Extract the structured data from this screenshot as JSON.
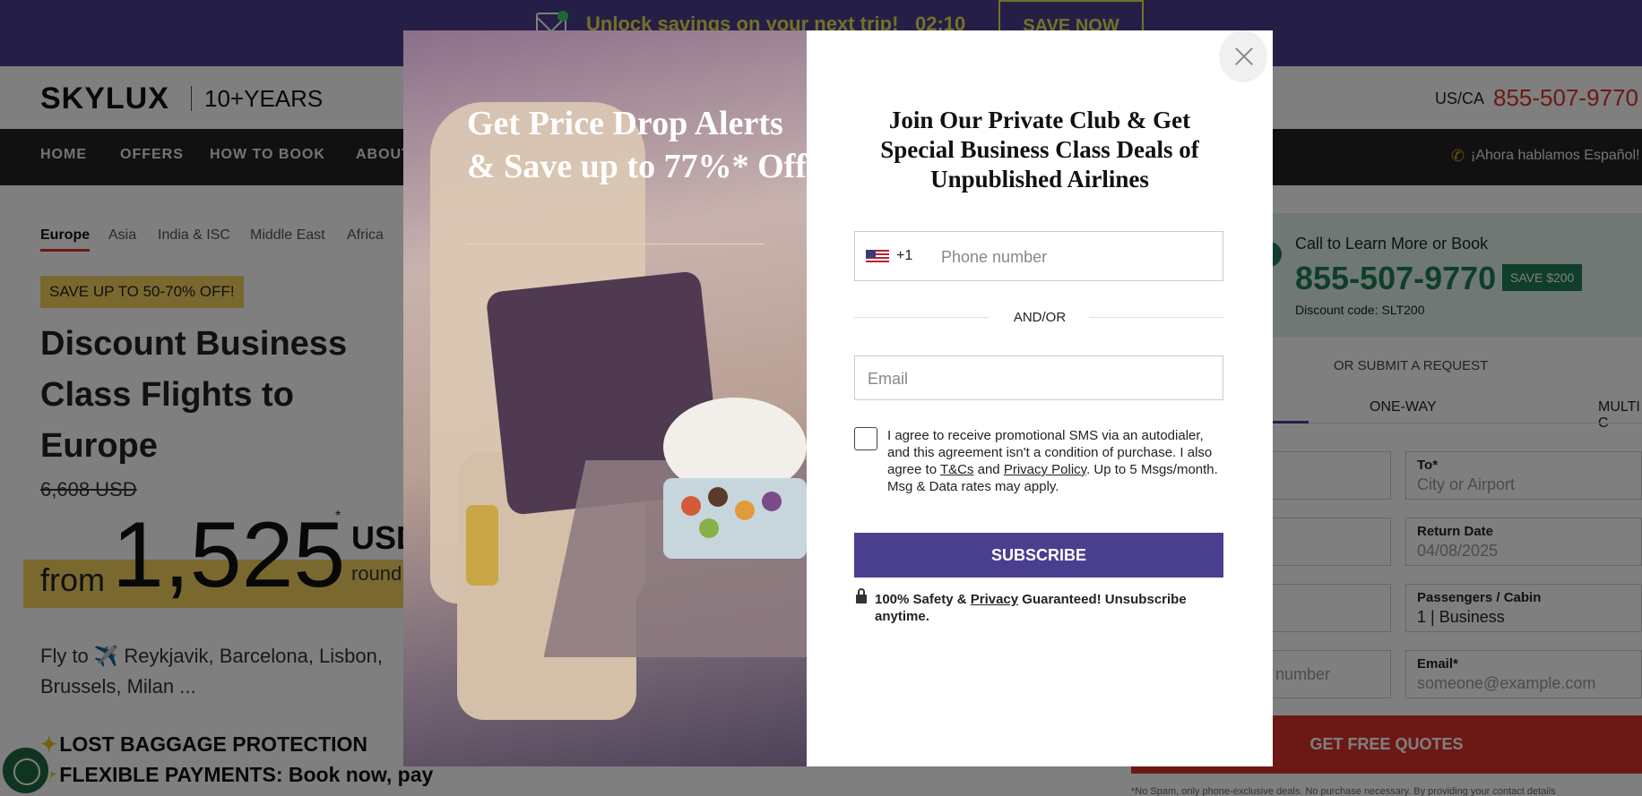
{
  "promo": {
    "text": "Unlock savings on your next trip!",
    "timer": "02:10",
    "button": "SAVE NOW"
  },
  "header": {
    "logo": "SKYLUX",
    "years": "10+YEARS",
    "region": "US/CA",
    "phone": "855-507-9770"
  },
  "nav": {
    "items": [
      "HOME",
      "OFFERS",
      "HOW TO BOOK",
      "ABOUT"
    ],
    "spanish": "¡Ahora hablamos Español!"
  },
  "region_tabs": [
    "Europe",
    "Asia",
    "India & ISC",
    "Middle East",
    "Africa"
  ],
  "main": {
    "badge": "SAVE UP TO 50-70% OFF!",
    "title": "Discount Business Class Flights to Europe",
    "old_price": "6,608 USD",
    "from": "from",
    "price": "1,525",
    "asterisk": "*",
    "currency": "USD",
    "round": "round",
    "fly_to": "Fly to ✈️ Reykjavik, Barcelona, Lisbon, Brussels, Milan ...",
    "perks": [
      "LOST BAGGAGE PROTECTION",
      "FLEXIBLE PAYMENTS: Book now, pay"
    ]
  },
  "request": {
    "call_title": "Call to Learn More or Book",
    "call_phone": "855-507-9770",
    "call_save": "SAVE $200",
    "discount_code": "Discount code: SLT200",
    "or_submit": "OR SUBMIT A REQUEST",
    "trip_tabs": [
      "ONE-WAY",
      "MULTI C"
    ],
    "to_label": "To*",
    "to_placeholder": "City or Airport",
    "return_label": "Return Date",
    "return_value": "04/08/2025",
    "passengers_label": "Passengers / Cabin",
    "passengers_value": "1 | Business",
    "phone_placeholder_fragment": "number",
    "email_label": "Email*",
    "email_placeholder": "someone@example.com",
    "quote_button": "GET FREE QUOTES",
    "disclaimer": "*No Spam, only phone-exclusive deals. No purchase necessary. By providing your contact details"
  },
  "modal": {
    "headline": "Get Price Drop Alerts & Save up to 77%* Off",
    "title": "Join Our Private Club & Get Special Business Class Deals of Unpublished Airlines",
    "dial_code": "+1",
    "phone_placeholder": "Phone number",
    "andor": "AND/OR",
    "email_placeholder": "Email",
    "consent_pre": "I agree to receive promotional SMS via an autodialer, and this agreement isn't a condition of purchase. I also agree to ",
    "consent_tcs": "T&Cs",
    "consent_and": " and ",
    "consent_privacy": "Privacy Policy",
    "consent_post": ". Up to 5 Msgs/month. Msg & Data rates may apply.",
    "subscribe": "SUBSCRIBE",
    "safety_pre": "100% Safety & ",
    "safety_privacy": "Privacy",
    "safety_post": " Guaranteed! Unsubscribe anytime."
  },
  "icons": {
    "promo": "mail-icon",
    "nav_phone": "phone-icon",
    "close": "close-icon",
    "lock": "lock-icon",
    "cookie": "cookie-icon",
    "flag": "us-flag-icon"
  },
  "colors": {
    "brand_purple": "#4a3f8f",
    "accent_red": "#d9322a",
    "promo_yellow": "#e7e24f",
    "call_green": "#1e7d54"
  }
}
